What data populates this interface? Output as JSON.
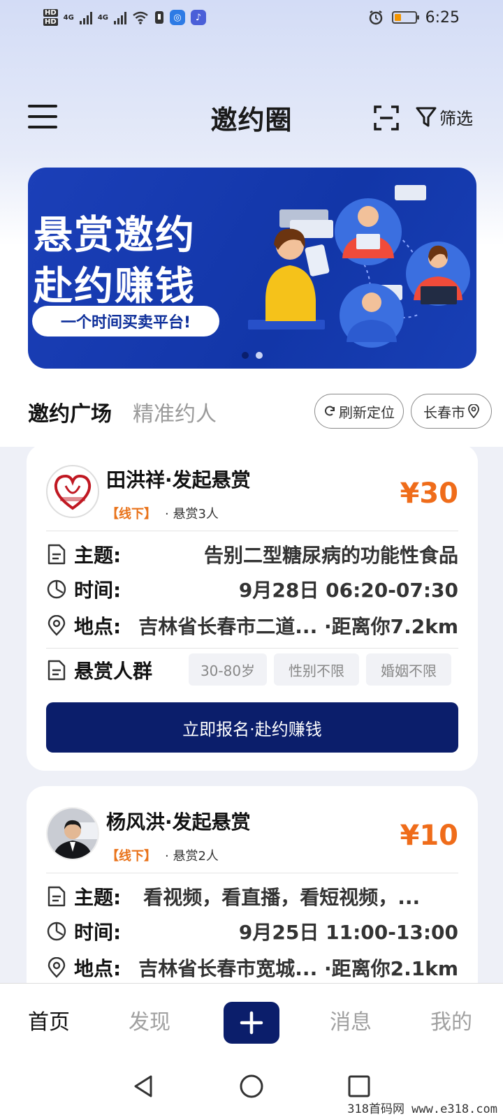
{
  "status_bar": {
    "hd1": "HD",
    "hd2": "HD",
    "sig1": "4G",
    "sig2": "4G",
    "time": "6:25"
  },
  "header": {
    "title": "邀约圈",
    "filter_label": "筛选"
  },
  "banner": {
    "line1": "悬赏邀约",
    "line2": "赴约赚钱",
    "pill": "一个时间买卖平台!",
    "slides_total": 2,
    "active_slide": 2
  },
  "tabs": {
    "active": "邀约广场",
    "inactive": "精准约人"
  },
  "chips": {
    "refresh": "刷新定位",
    "city": "长春市"
  },
  "cards": [
    {
      "name": "田洪祥·发起悬赏",
      "tag": "【线下】",
      "count": "· 悬赏3人",
      "reward": "¥30",
      "topic_label": "主题:",
      "topic": "告别二型糖尿病的功能性食品",
      "time_label": "时间:",
      "time": "9月28日 06:20-07:30",
      "place_label": "地点:",
      "place": "吉林省长春市二道... ·距离你7.2km",
      "crowd_label": "悬赏人群",
      "crowd_tags": [
        "30-80岁",
        "性别不限",
        "婚姻不限"
      ],
      "cta": "立即报名·赴约赚钱"
    },
    {
      "name": "杨风洪·发起悬赏",
      "tag": "【线下】",
      "count": "· 悬赏2人",
      "reward": "¥10",
      "topic_label": "主题:",
      "topic": "看视频，看直播，看短视频，...",
      "time_label": "时间:",
      "time": "9月25日 11:00-13:00",
      "place_label": "地点:",
      "place": "吉林省长春市宽城... ·距离你2.1km"
    }
  ],
  "bottom_nav": {
    "home": "首页",
    "discover": "发现",
    "messages": "消息",
    "mine": "我的"
  },
  "watermark": "318首码网 www.e318.com",
  "colors": {
    "accent_navy": "#0b1e6b",
    "reward_orange": "#ef6c1a",
    "banner_blue": "#1236a8"
  }
}
